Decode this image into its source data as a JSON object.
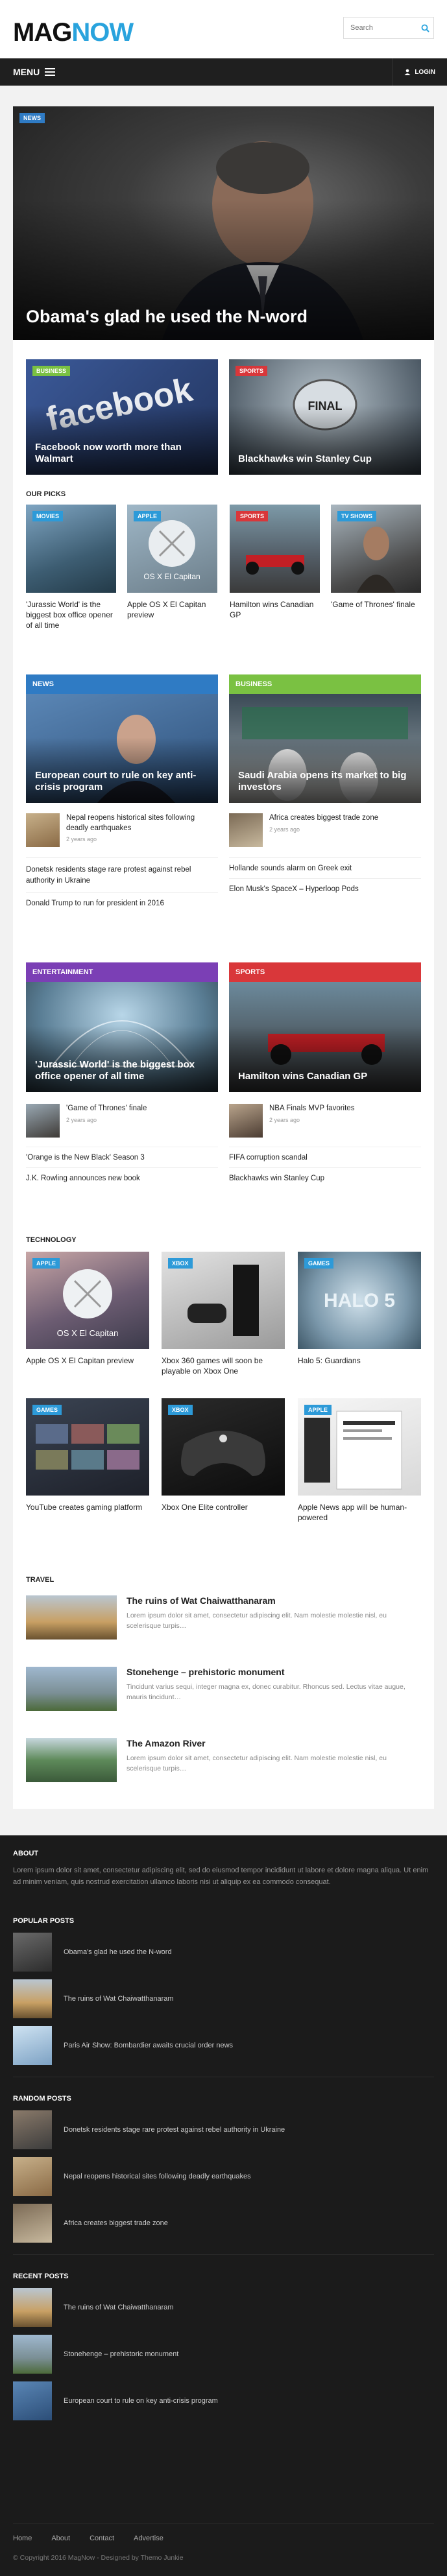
{
  "header": {
    "logo_part1": "MAG",
    "logo_part2": "NOW",
    "search_placeholder": "Search",
    "menu_label": "MENU",
    "login_label": "LOGIN"
  },
  "hero": {
    "tag": "NEWS",
    "title": "Obama's glad he used the N-word"
  },
  "features": [
    {
      "tag": "BUSINESS",
      "title": "Facebook now worth more than Walmart"
    },
    {
      "tag": "SPORTS",
      "title": "Blackhawks win Stanley Cup"
    }
  ],
  "our_picks": {
    "title": "OUR PICKS",
    "items": [
      {
        "tag": "MOVIES",
        "caption": "'Jurassic World' is the biggest box office opener of all time"
      },
      {
        "tag": "APPLE",
        "caption": "Apple OS X El Capitan preview"
      },
      {
        "tag": "SPORTS",
        "caption": "Hamilton wins Canadian GP"
      },
      {
        "tag": "TV SHOWS",
        "caption": "'Game of Thrones' finale"
      }
    ]
  },
  "block_news": {
    "bar": "NEWS",
    "feature": "European court to rule on key anti-crisis program",
    "small": {
      "title": "Nepal reopens historical sites following deadly earthquakes",
      "meta": "2 years ago"
    },
    "lines": [
      "Donetsk residents stage rare protest against rebel authority in Ukraine",
      "Donald Trump to run for president in 2016"
    ]
  },
  "block_business": {
    "bar": "BUSINESS",
    "feature": "Saudi Arabia opens its market to big investors",
    "small": {
      "title": "Africa creates biggest trade zone",
      "meta": "2 years ago"
    },
    "lines": [
      "Hollande sounds alarm on Greek exit",
      "Elon Musk's SpaceX – Hyperloop Pods"
    ]
  },
  "block_entertainment": {
    "bar": "ENTERTAINMENT",
    "feature": "'Jurassic World' is the biggest box office opener of all time",
    "small": {
      "title": "'Game of Thrones' finale",
      "meta": "2 years ago"
    },
    "lines": [
      "'Orange is the New Black' Season 3",
      "J.K. Rowling announces new book"
    ]
  },
  "block_sports": {
    "bar": "SPORTS",
    "feature": "Hamilton wins Canadian GP",
    "small": {
      "title": "NBA Finals MVP favorites",
      "meta": "2 years ago"
    },
    "lines": [
      "FIFA corruption scandal",
      "Blackhawks win Stanley Cup"
    ]
  },
  "technology": {
    "title": "TECHNOLOGY",
    "items": [
      {
        "tag": "APPLE",
        "caption": "Apple OS X El Capitan preview"
      },
      {
        "tag": "XBOX",
        "caption": "Xbox 360 games will soon be playable on Xbox One"
      },
      {
        "tag": "GAMES",
        "caption": "Halo 5: Guardians"
      },
      {
        "tag": "GAMES",
        "caption": "YouTube creates gaming platform"
      },
      {
        "tag": "XBOX",
        "caption": "Xbox One Elite controller"
      },
      {
        "tag": "APPLE",
        "caption": "Apple News app will be human-powered"
      }
    ]
  },
  "travel": {
    "title": "TRAVEL",
    "items": [
      {
        "title": "The ruins of Wat Chaiwatthanaram",
        "excerpt": "Lorem ipsum dolor sit amet, consectetur adipiscing elit. Nam molestie molestie nisl, eu scelerisque turpis…"
      },
      {
        "title": "Stonehenge – prehistoric monument",
        "excerpt": "Tincidunt varius sequi, integer magna ex, donec curabitur. Rhoncus sed. Lectus vitae augue, mauris tincidunt…"
      },
      {
        "title": "The Amazon River",
        "excerpt": "Lorem ipsum dolor sit amet, consectetur adipiscing elit. Nam molestie molestie nisl, eu scelerisque turpis…"
      }
    ]
  },
  "footer": {
    "about_title": "ABOUT",
    "about_text": "Lorem ipsum dolor sit amet, consectetur adipiscing elit, sed do eiusmod tempor incididunt ut labore et dolore magna aliqua. Ut enim ad minim veniam, quis nostrud exercitation ullamco laboris nisi ut aliquip ex ea commodo consequat.",
    "popular_title": "POPULAR POSTS",
    "popular": [
      "Obama's glad he used the N-word",
      "The ruins of Wat Chaiwatthanaram",
      "Paris Air Show: Bombardier awaits crucial order news"
    ],
    "random_title": "RANDOM POSTS",
    "random": [
      "Donetsk residents stage rare protest against rebel authority in Ukraine",
      "Nepal reopens historical sites following deadly earthquakes",
      "Africa creates biggest trade zone"
    ],
    "recent_title": "RECENT POSTS",
    "recent": [
      "The ruins of Wat Chaiwatthanaram",
      "Stonehenge – prehistoric monument",
      "European court to rule on key anti-crisis program"
    ],
    "links": [
      "Home",
      "About",
      "Contact",
      "Advertise"
    ],
    "copyright": "© Copyright 2016 MagNow - Designed by Themo Junkie"
  },
  "colors": {
    "accent": "#29a3dd",
    "news": "#2f7bc4",
    "business": "#7ac142",
    "entertainment": "#7b3fb5",
    "sports": "#d9373a",
    "tv": "#2d9ad8",
    "footer": "#1b1b1b"
  },
  "icons": {
    "search": "search-icon",
    "menu": "hamburger-icon",
    "login": "user-icon"
  }
}
